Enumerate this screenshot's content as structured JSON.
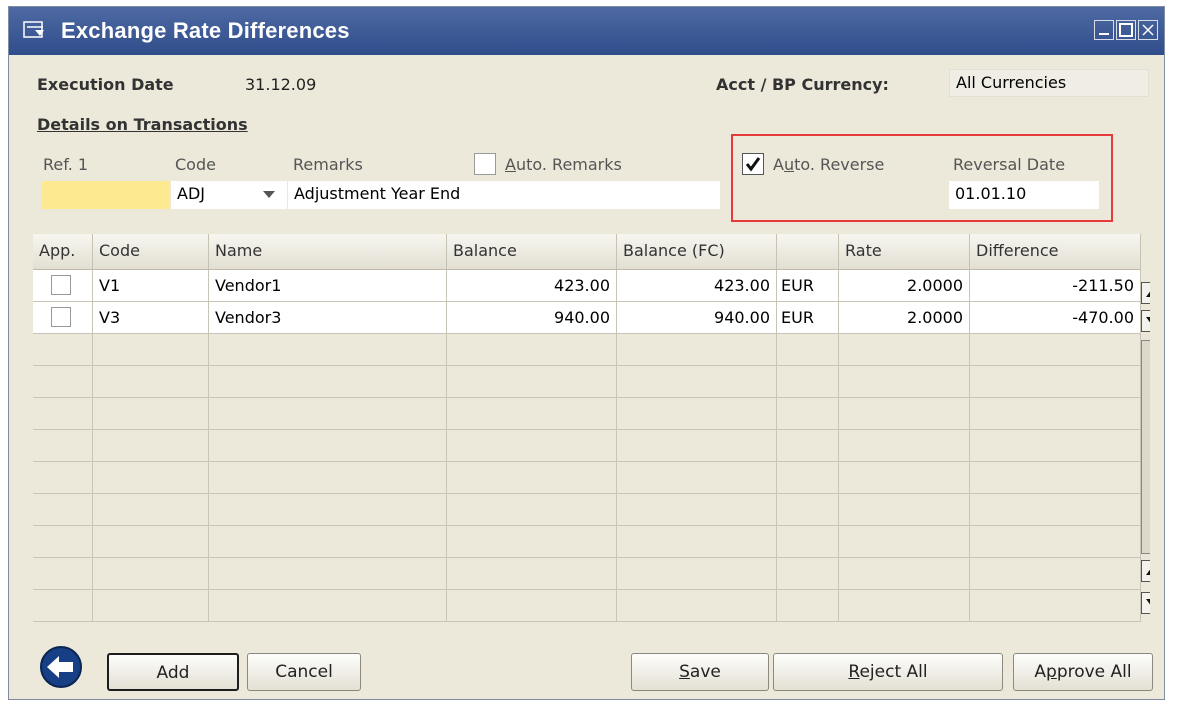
{
  "window": {
    "title": "Exchange Rate Differences"
  },
  "header": {
    "execution_date_label": "Execution Date",
    "execution_date_value": "31.12.09",
    "currency_label": "Acct / BP Currency:",
    "currency_value": "All Currencies"
  },
  "details": {
    "heading": "Details on Transactions",
    "ref1_label": "Ref. 1",
    "ref1_value": "",
    "code_label": "Code",
    "code_value": "ADJ",
    "remarks_label": "Remarks",
    "remarks_value": "Adjustment Year End",
    "auto_remarks": {
      "label_pre": "",
      "label_u": "A",
      "label_post": "uto. Remarks",
      "checked": false
    },
    "auto_reverse": {
      "label_pre": "A",
      "label_u": "u",
      "label_post": "to. Reverse",
      "checked": true
    },
    "reversal_date_label": "Reversal Date",
    "reversal_date_value": "01.01.10"
  },
  "grid": {
    "columns": [
      "App.",
      "Code",
      "Name",
      "Balance",
      "Balance (FC)",
      "",
      "Rate",
      "Difference"
    ],
    "rows": [
      {
        "approved": false,
        "code": "V1",
        "name": "Vendor1",
        "balance": "423.00",
        "balance_fc": "423.00",
        "currency": "EUR",
        "rate": "2.0000",
        "difference": "-211.50"
      },
      {
        "approved": false,
        "code": "V3",
        "name": "Vendor3",
        "balance": "940.00",
        "balance_fc": "940.00",
        "currency": "EUR",
        "rate": "2.0000",
        "difference": "-470.00"
      }
    ]
  },
  "buttons": {
    "add": "Add",
    "cancel": "Cancel",
    "save_u": "S",
    "save_rest": "ave",
    "reject_u": "R",
    "reject_rest": "eject All",
    "approve_pre": "A",
    "approve_u": "p",
    "approve_rest": "prove All"
  },
  "colors": {
    "titlebar": "#2f4d8b",
    "highlight_border": "#e63b3b",
    "ref_field": "#fde98f",
    "window_bg": "#ece9db"
  }
}
